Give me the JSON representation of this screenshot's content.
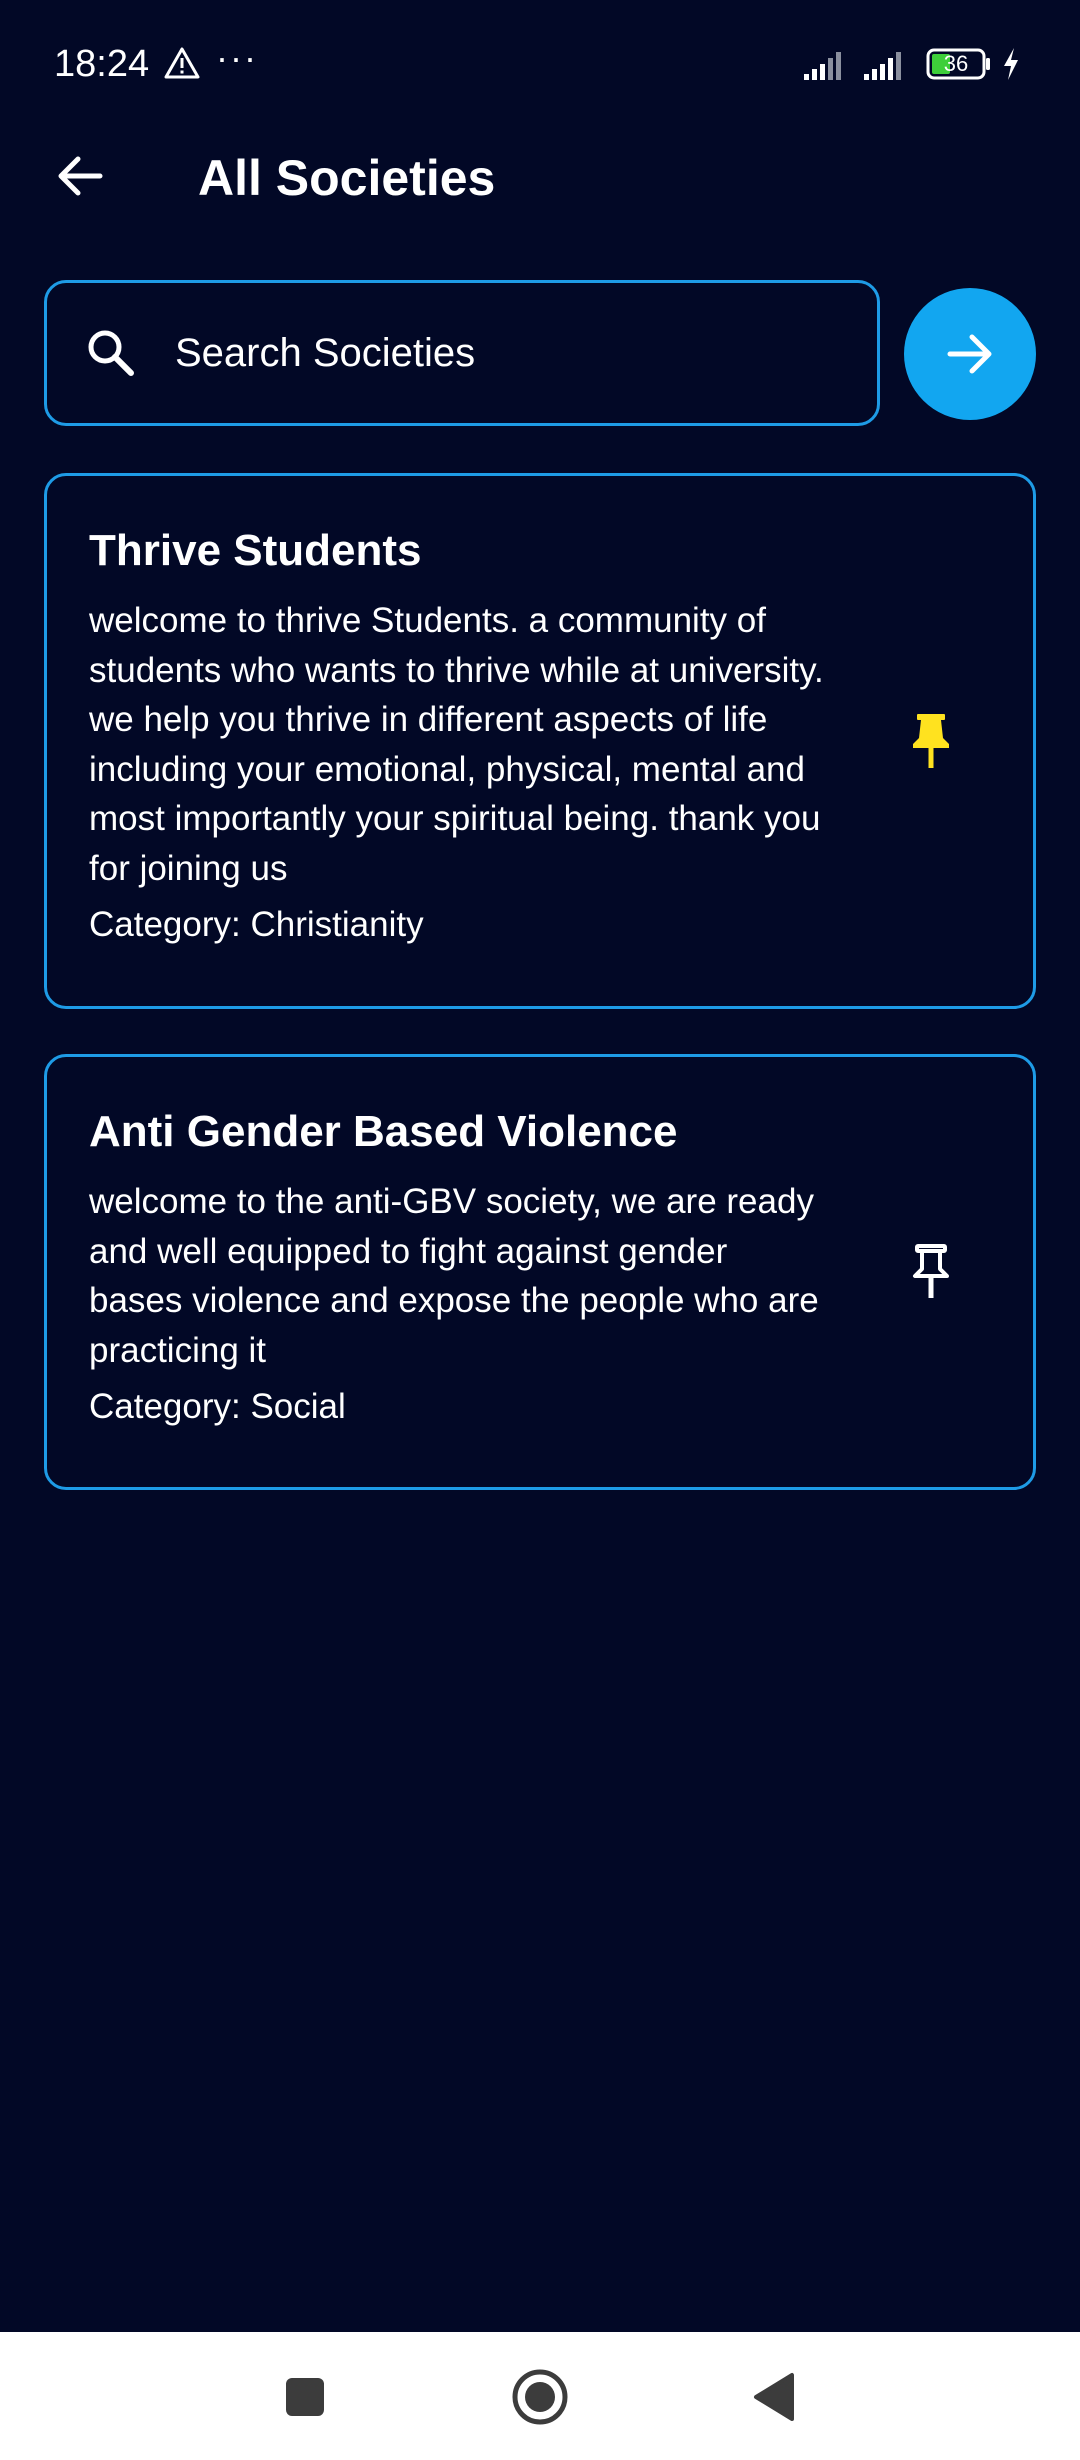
{
  "status_bar": {
    "time": "18:24",
    "more": "···",
    "battery": "36",
    "icons": [
      "warning-icon",
      "signal-icon",
      "signal-icon",
      "battery-icon",
      "charging-icon"
    ]
  },
  "header": {
    "title": "All Societies",
    "back_icon": "arrow-left-icon"
  },
  "search": {
    "placeholder": "Search Societies",
    "value": "",
    "icon": "search-icon",
    "go_icon": "arrow-right-icon"
  },
  "societies": [
    {
      "name": "Thrive Students",
      "description": "welcome to thrive Students. a community of students who wants to thrive while at university. we help you thrive in different aspects of life including your emotional, physical, mental and most importantly your spiritual being. thank you for joining us",
      "category": "Category: Christianity",
      "pinned": true,
      "pin_color": "#ffe21f"
    },
    {
      "name": "Anti Gender Based Violence",
      "description": "welcome to the anti-GBV society, we are ready and well equipped to fight against gender bases violence and expose the people who are practicing it",
      "category": "Category: Social",
      "pinned": false,
      "pin_color": "#ffffff"
    }
  ],
  "colors": {
    "background": "#020826",
    "accent": "#1e9be6",
    "go_button": "#12a6f0",
    "pinned": "#ffe21f"
  },
  "nav_bar": {
    "icons": [
      "recents-icon",
      "home-icon",
      "back-icon"
    ]
  }
}
